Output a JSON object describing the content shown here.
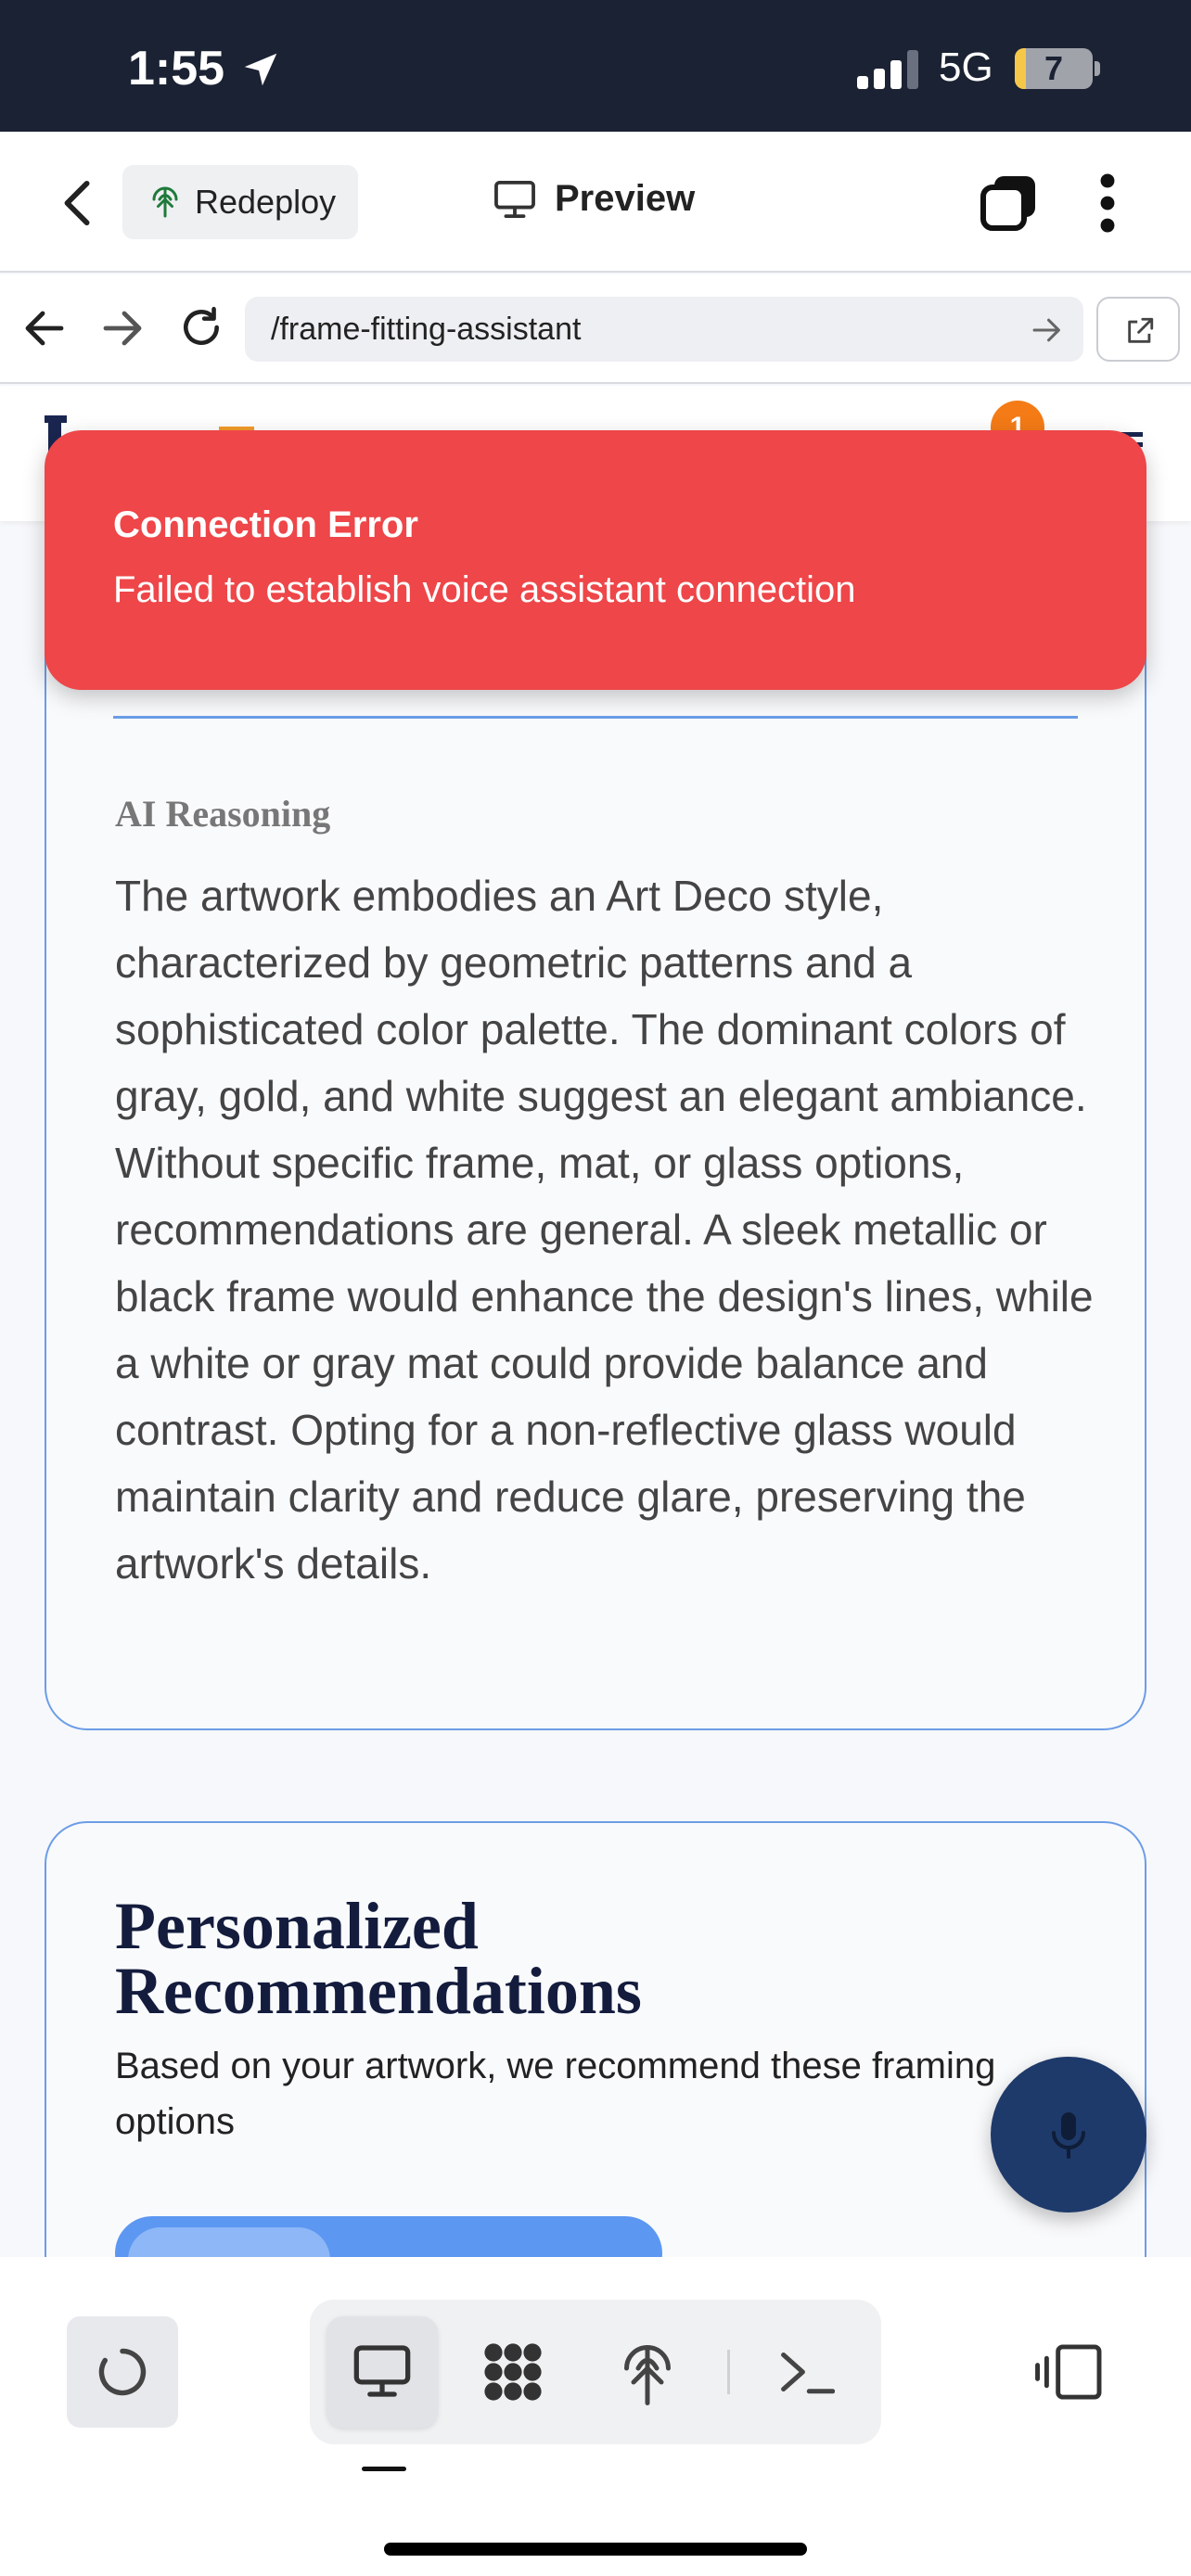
{
  "status_bar": {
    "time": "1:55",
    "network": "5G",
    "battery_level": "7"
  },
  "app_bar": {
    "redeploy_label": "Redeploy",
    "preview_label": "Preview"
  },
  "url_bar": {
    "path": "/frame-fitting-assistant"
  },
  "page_header": {
    "notification_count": "1"
  },
  "toast": {
    "title": "Connection Error",
    "message": "Failed to establish voice assistant connection",
    "color": "#ee4649"
  },
  "reasoning": {
    "heading": "AI Reasoning",
    "body": "The artwork embodies an Art Deco style, characterized by geometric patterns and a sophisticated color palette. The dominant colors of gray, gold, and white suggest an elegant ambiance. Without specific frame, mat, or glass options, recommendations are general. A sleek metallic or black frame would enhance the design's lines, while a white or gray mat could provide balance and contrast. Opting for a non-reflective glass would maintain clarity and reduce glare, preserving the artwork's details."
  },
  "recommendations": {
    "title": "Personalized Recommendations",
    "subtitle": "Based on your artwork, we recommend these framing options"
  },
  "colors": {
    "accent_blue": "#6b9de6",
    "fab_navy": "#1e3a6b",
    "badge_orange": "#f47b16"
  },
  "icons": {
    "mic_fab": "microphone-icon",
    "toolbar": [
      "spinner-icon",
      "monitor-icon",
      "grid-icon",
      "antenna-icon",
      "terminal-icon",
      "panel-icon"
    ]
  }
}
